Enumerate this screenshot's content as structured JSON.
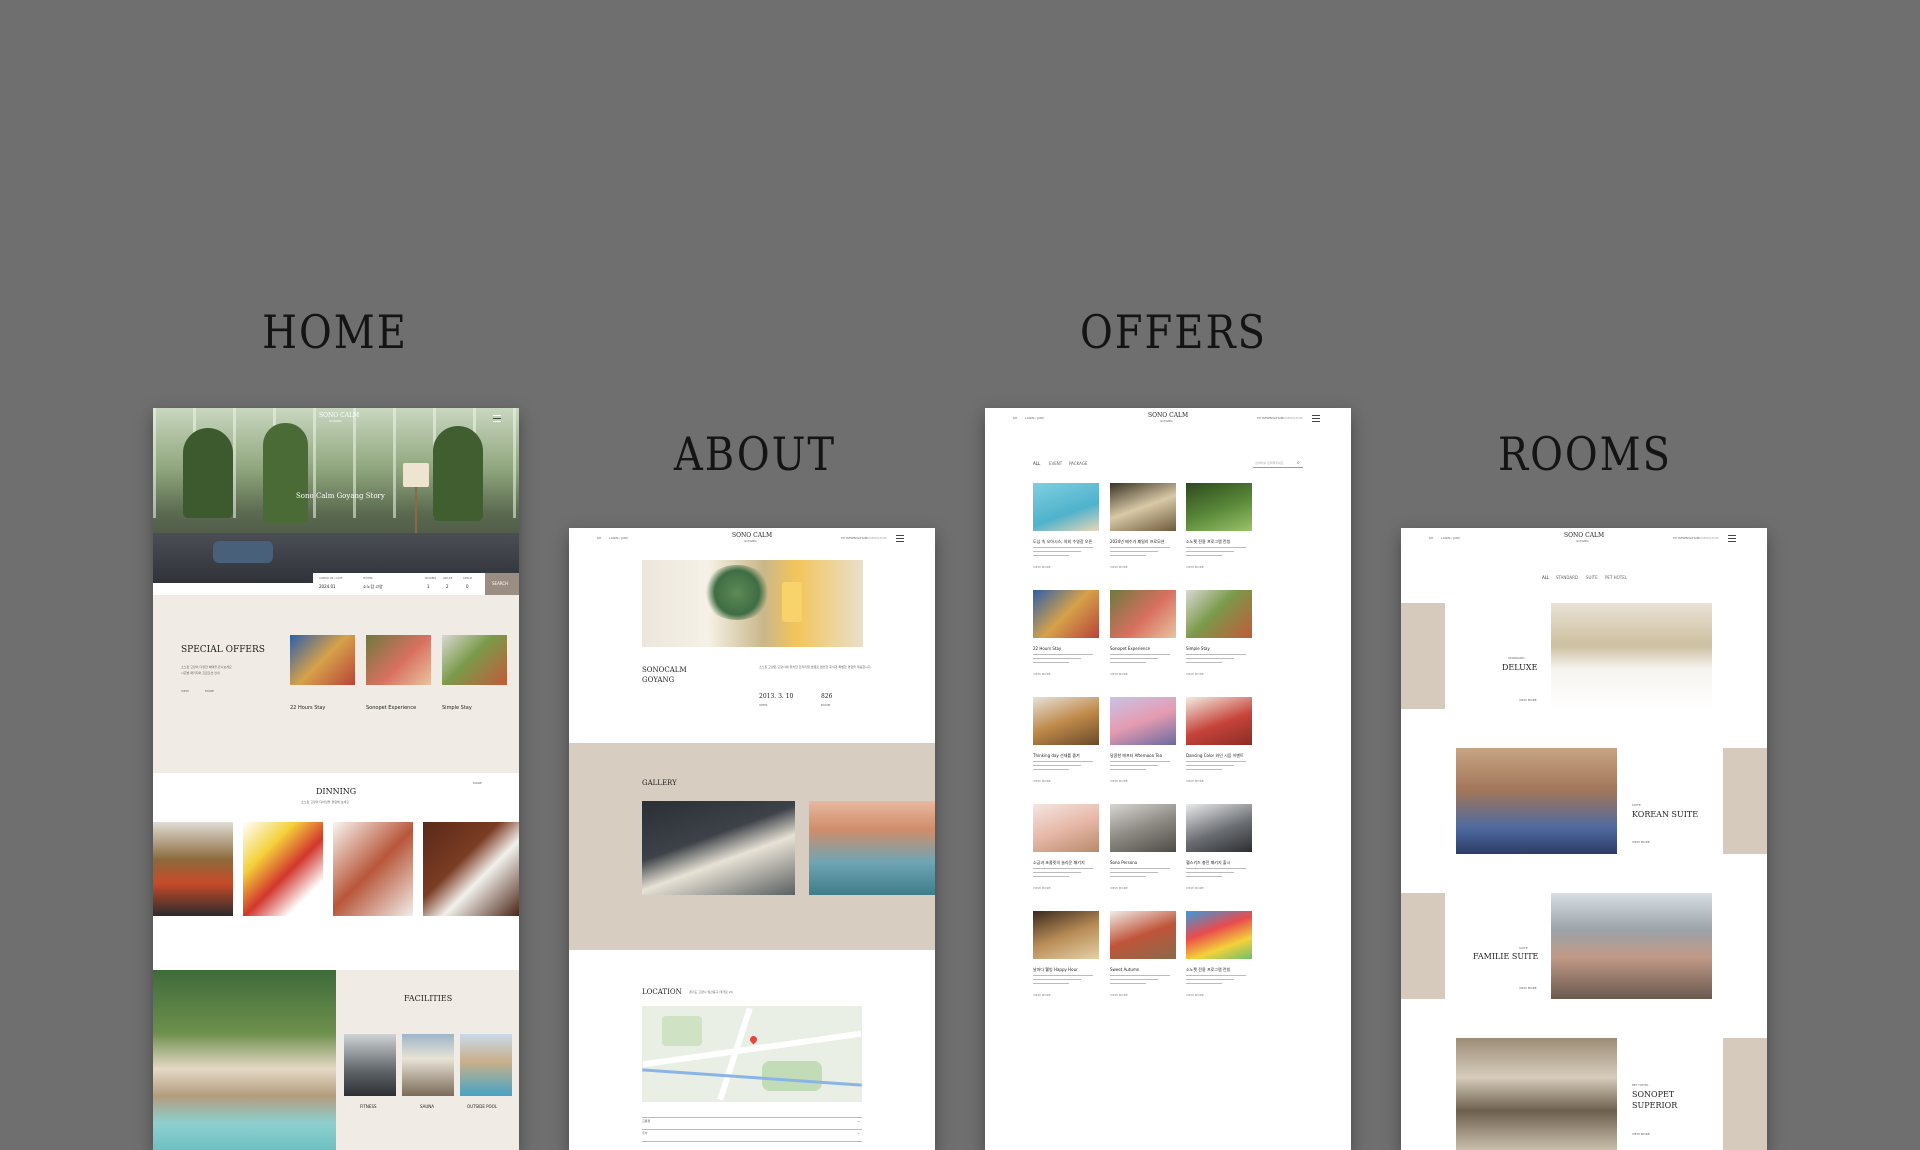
{
  "sections": {
    "home": "HOME",
    "about": "ABOUT",
    "offers": "OFFERS",
    "rooms": "ROOMS"
  },
  "brand": {
    "name": "SONO CALM",
    "sub": "GOYANG"
  },
  "header": {
    "lang": "KO",
    "nav_left": "LOGIN / JOIN",
    "nav_right_1": "MY RESERVATION",
    "nav_right_2": "RESERVATION"
  },
  "home": {
    "hero_text": "Sono Calm Goyang Story",
    "booking": {
      "checkin_label": "CHECK IN / OUT",
      "checkin_value": "2024.01",
      "hotel_label": "HOTEL",
      "hotel_value": "소노캄 고양",
      "rooms_label": "ROOMS",
      "rooms_value": "1",
      "adult_label": "ADULT",
      "adult_value": "2",
      "child_label": "CHILD",
      "child_value": "0",
      "search": "SEARCH"
    },
    "special_offers": {
      "title": "SPECIAL OFFERS",
      "desc_1": "소노캄 고양의 다양한 혜택을 만나보세요",
      "desc_2": "시즌별 패키지와 프로모션 안내",
      "link_1": "VIEW",
      "link_2": "MORE",
      "cards": [
        "22 Hours Stay",
        "Sonopet Experience",
        "Simple Stay"
      ]
    },
    "dining": {
      "title": "DINNING",
      "desc": "소노캄 고양의 다이닝을 경험해 보세요",
      "more": "MORE"
    },
    "facilities": {
      "title": "FACILITIES",
      "items": [
        "FITNESS",
        "SAUNA",
        "OUTSIDE POOL"
      ]
    }
  },
  "about": {
    "name_1": "SONOCALM",
    "name_2": "GOYANG",
    "desc": "소노캄 고양은 고양시에 위치한 프리미엄 호텔로 편안한 휴식과 특별한 경험을 제공합니다.",
    "stat_1_value": "2013. 3. 10",
    "stat_1_label": "OPEN",
    "stat_2_value": "826",
    "stat_2_label": "ROOM",
    "gallery_title": "GALLERY",
    "location_title": "LOCATION",
    "location_addr": "경기도 고양시 일산동구 태극로 20",
    "accordion": [
      "교통편",
      "주차"
    ]
  },
  "offers": {
    "tabs": [
      "ALL",
      "EVENT",
      "PACKAGE"
    ],
    "search_placeholder": "검색어를 입력해주세요",
    "more": "VIEW MORE",
    "cards": [
      "도심 속 오아시스, 야외 수영장 오픈",
      "2024년 배수가 패밀리 프로모션",
      "소노펫 전용 프로그램 런칭",
      "22 Hours Stay",
      "Sonopet Experience",
      "Simple Stay",
      "Thinking day 선재를 즐겨",
      "달콤한 애프터 Afternoon Tea",
      "Dancing Color 와인 시음 이벤트",
      "소금과 초콜릿의 놀라운 패키지",
      "Sono Persona",
      "헬스키즈 충전 패키지 출시",
      "날마다 웰빙 Happy Hour",
      "Sweet Autumn",
      "소노펫 전용 프로그램 런칭"
    ]
  },
  "rooms": {
    "tabs": [
      "ALL",
      "STANDARD",
      "SUITE",
      "PET HOTEL"
    ],
    "list": [
      {
        "cat": "STANDARD",
        "name": "DELUXE",
        "more": "VIEW MORE"
      },
      {
        "cat": "SUITE",
        "name": "KOREAN SUITE",
        "more": "VIEW MORE"
      },
      {
        "cat": "SUITE",
        "name": "FAMILIE SUITE",
        "more": "VIEW MORE"
      },
      {
        "cat": "PET HOTEL",
        "name_1": "SONOPET",
        "name_2": "SUPERIOR",
        "more": "VIEW MORE"
      }
    ]
  }
}
